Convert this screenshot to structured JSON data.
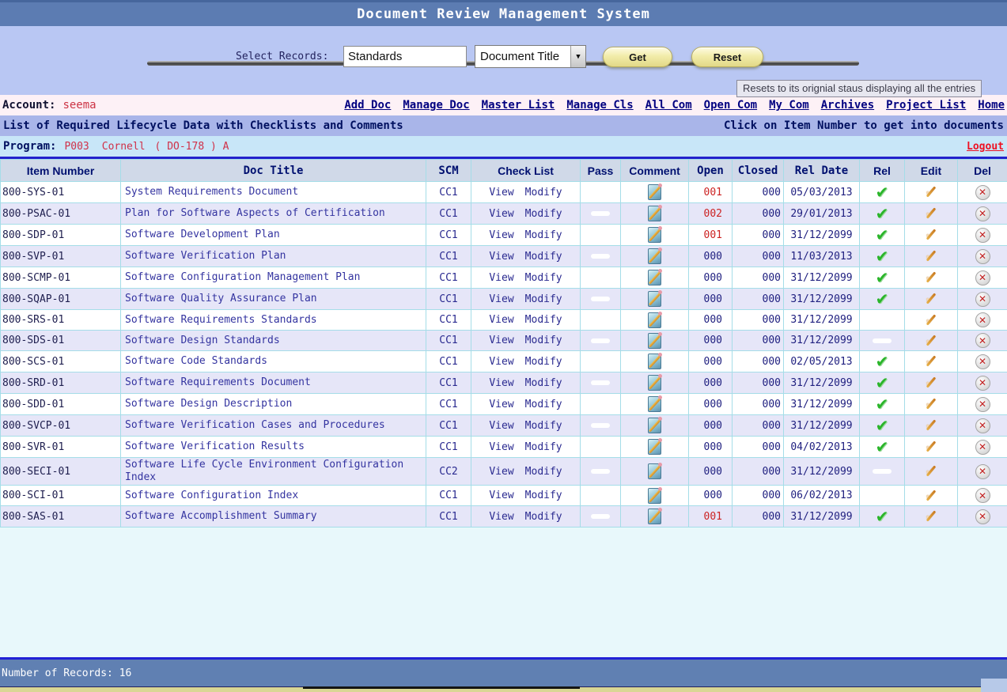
{
  "title": "Document Review Management System",
  "search": {
    "label": "Select Records:",
    "value": "Standards",
    "dropdown_value": "Document Title",
    "get_label": "Get",
    "reset_label": "Reset",
    "tooltip": "Resets to its orignial staus displaying all the entries"
  },
  "account": {
    "label": "Account:",
    "username": "seema"
  },
  "nav": {
    "links": [
      "Add Doc",
      "Manage Doc",
      "Master List",
      "Manage Cls",
      "All Com",
      "Open Com",
      "My Com",
      "Archives",
      "Project List",
      "Home"
    ]
  },
  "section": {
    "title": "List of Required Lifecycle Data with Checklists and Comments",
    "hint": "Click on Item Number to get into documents"
  },
  "program": {
    "label": "Program:",
    "code": "P003",
    "name": "Cornell",
    "cert": "( DO-178 ) A",
    "logout_label": "Logout"
  },
  "table": {
    "headers": [
      "Item Number",
      "Doc Title",
      "SCM",
      "Check List",
      "Pass",
      "Comment",
      "Open",
      "Closed",
      "Rel Date",
      "Rel",
      "Edit",
      "Del"
    ],
    "view_label": "View",
    "modify_label": "Modify",
    "rows": [
      {
        "item": "800-SYS-01",
        "title": "System Requirements Document",
        "scm": "CC1",
        "pass": "",
        "open": "001",
        "closed": "000",
        "rel_date": "05/03/2013",
        "rel": "check"
      },
      {
        "item": "800-PSAC-01",
        "title": "Plan for Software Aspects of Certification",
        "scm": "CC1",
        "pass": "dash",
        "open": "002",
        "closed": "000",
        "rel_date": "29/01/2013",
        "rel": "check"
      },
      {
        "item": "800-SDP-01",
        "title": "Software Development Plan",
        "scm": "CC1",
        "pass": "",
        "open": "001",
        "closed": "000",
        "rel_date": "31/12/2099",
        "rel": "check"
      },
      {
        "item": "800-SVP-01",
        "title": "Software Verification Plan",
        "scm": "CC1",
        "pass": "dash",
        "open": "000",
        "closed": "000",
        "rel_date": "11/03/2013",
        "rel": "check"
      },
      {
        "item": "800-SCMP-01",
        "title": "Software Configuration Management Plan",
        "scm": "CC1",
        "pass": "",
        "open": "000",
        "closed": "000",
        "rel_date": "31/12/2099",
        "rel": "check"
      },
      {
        "item": "800-SQAP-01",
        "title": "Software Quality Assurance Plan",
        "scm": "CC1",
        "pass": "dash",
        "open": "000",
        "closed": "000",
        "rel_date": "31/12/2099",
        "rel": "check"
      },
      {
        "item": "800-SRS-01",
        "title": "Software Requirements Standards",
        "scm": "CC1",
        "pass": "",
        "open": "000",
        "closed": "000",
        "rel_date": "31/12/2099",
        "rel": ""
      },
      {
        "item": "800-SDS-01",
        "title": "Software Design Standards",
        "scm": "CC1",
        "pass": "dash",
        "open": "000",
        "closed": "000",
        "rel_date": "31/12/2099",
        "rel": "dash"
      },
      {
        "item": "800-SCS-01",
        "title": "Software Code Standards",
        "scm": "CC1",
        "pass": "",
        "open": "000",
        "closed": "000",
        "rel_date": "02/05/2013",
        "rel": "check"
      },
      {
        "item": "800-SRD-01",
        "title": "Software Requirements Document",
        "scm": "CC1",
        "pass": "dash",
        "open": "000",
        "closed": "000",
        "rel_date": "31/12/2099",
        "rel": "check"
      },
      {
        "item": "800-SDD-01",
        "title": "Software Design Description",
        "scm": "CC1",
        "pass": "",
        "open": "000",
        "closed": "000",
        "rel_date": "31/12/2099",
        "rel": "check"
      },
      {
        "item": "800-SVCP-01",
        "title": "Software Verification Cases and Procedures",
        "scm": "CC1",
        "pass": "dash",
        "open": "000",
        "closed": "000",
        "rel_date": "31/12/2099",
        "rel": "check"
      },
      {
        "item": "800-SVR-01",
        "title": "Software Verification Results",
        "scm": "CC1",
        "pass": "",
        "open": "000",
        "closed": "000",
        "rel_date": "04/02/2013",
        "rel": "check"
      },
      {
        "item": "800-SECI-01",
        "title": "Software Life Cycle Environment Configuration Index",
        "scm": "CC2",
        "pass": "dash",
        "open": "000",
        "closed": "000",
        "rel_date": "31/12/2099",
        "rel": "dash"
      },
      {
        "item": "800-SCI-01",
        "title": "Software Configuration Index",
        "scm": "CC1",
        "pass": "",
        "open": "000",
        "closed": "000",
        "rel_date": "06/02/2013",
        "rel": ""
      },
      {
        "item": "800-SAS-01",
        "title": "Software Accomplishment Summary",
        "scm": "CC1",
        "pass": "dash",
        "open": "001",
        "closed": "000",
        "rel_date": "31/12/2099",
        "rel": "check"
      }
    ]
  },
  "footer": {
    "records_text": "Number of Records: 16"
  },
  "colors": {
    "titlebar_blue": "#5c7cb2",
    "form_periwinkle": "#b9c7f3",
    "section_periwinkle": "#a9b5e9",
    "program_lightblue": "#c8e6f8",
    "row_alt_lavender": "#e6e6f8",
    "table_border_cyan": "#a5dde8",
    "link_navy": "#000080",
    "alert_red": "#cc2222",
    "released_green": "#2ab52a",
    "button_yellow": "#f2ecaa"
  }
}
